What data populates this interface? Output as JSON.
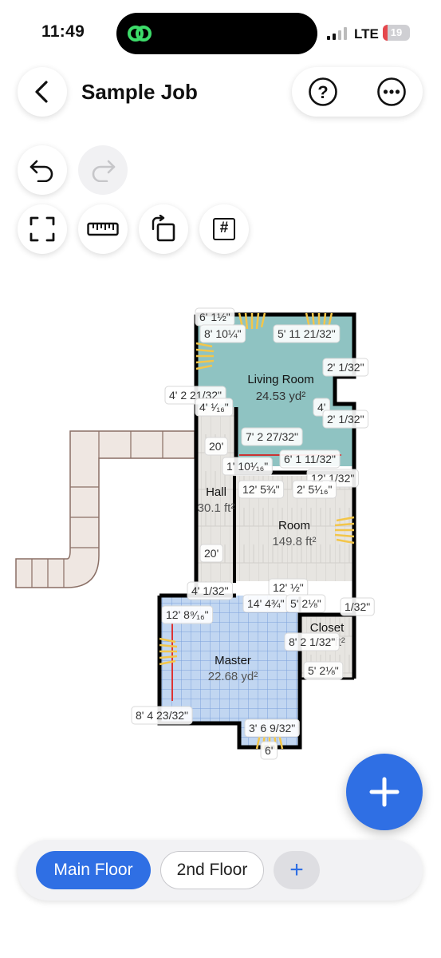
{
  "status_bar": {
    "time": "11:49",
    "network": "LTE",
    "battery": "19",
    "battery_percent": 19
  },
  "header": {
    "title": "Sample Job",
    "help_symbol": "?"
  },
  "toolbar": {
    "grid_symbol": "#"
  },
  "plan": {
    "rooms": [
      {
        "name": "Living Room",
        "area": "24.53 yd²"
      },
      {
        "name": "Hall",
        "area": "30.1 ft²"
      },
      {
        "name": "Room",
        "area": "149.8 ft²"
      },
      {
        "name": "Master",
        "area": "22.68 yd²"
      },
      {
        "name": "Closet",
        "area": "11.3 ft²"
      }
    ],
    "dimensions": [
      "6' 1½\"",
      "8' 10¼\"",
      "5' 11 21/32\"",
      "2' 1/32\"",
      "4' 2 21/32\"",
      "4' ¹⁄₁₆\"",
      "4'",
      "2' 1/32\"",
      "7' 2 27/32\"",
      "20'",
      "6' 1 11/32\"",
      "1' 10¹⁄₁₆\"",
      "12' 1/32\"",
      "12' 5¾\"",
      "2' 5¹⁄₁₆\"",
      "20'",
      "4' 1/32\"",
      "12' ½\"",
      "14' 4¾\"",
      "5' 2⅛\"",
      "1/32\"",
      "12' 8⁹⁄₁₆\"",
      "8' 2 1/32\"",
      "5' 2⅛\"",
      "8' 4 23/32\"",
      "3' 6 9/32\"",
      "6'"
    ]
  },
  "floors": {
    "tabs": [
      "Main Floor",
      "2nd Floor"
    ],
    "add": "+"
  },
  "colors": {
    "accent": "#2f6fe4",
    "living": "#8fc3c2",
    "master": "#bcd3ef",
    "window": "#f3c64a"
  }
}
